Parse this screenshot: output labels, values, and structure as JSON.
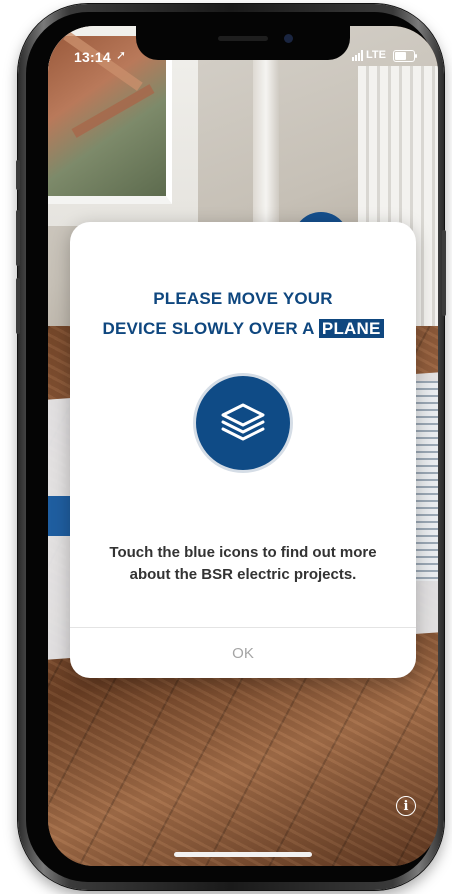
{
  "status_bar": {
    "time": "13:14",
    "location_glyph": "➚",
    "network": "LTE"
  },
  "dialog": {
    "title_line1": "PLEASE MOVE YOUR",
    "title_line2_prefix": "DEVICE SLOWLY OVER A ",
    "title_highlight": "PLANE",
    "icon": "layers-icon",
    "message_line1": "Touch the blue icons to find out more",
    "message_line2": "about the BSR electric projects.",
    "ok_label": "OK"
  },
  "info_button": {
    "label": "i",
    "icon": "info-icon"
  },
  "colors": {
    "brand_blue": "#0f477f",
    "ok_text": "#a5a5a5",
    "message_text": "#333333"
  }
}
